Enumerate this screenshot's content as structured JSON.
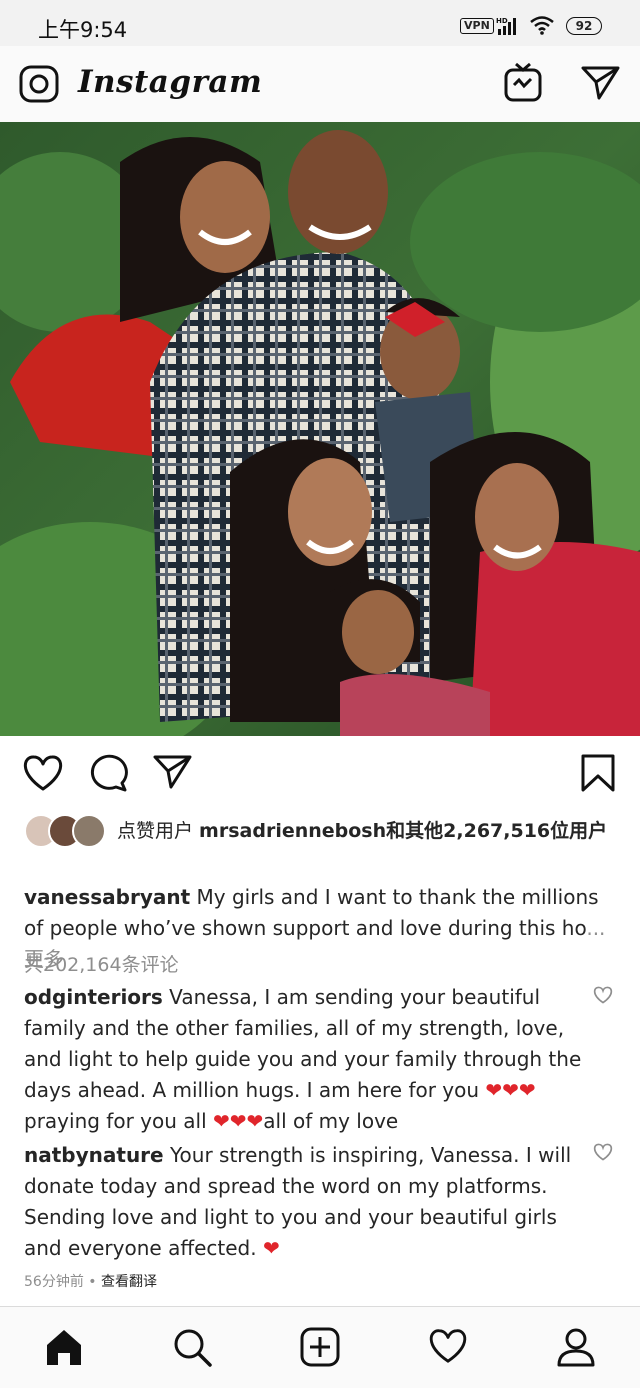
{
  "status_bar": {
    "time": "上午9:54",
    "vpn": "VPN",
    "network": "HD",
    "battery": "92"
  },
  "header": {
    "app_name": "Instagram",
    "icons": [
      "camera-icon",
      "igtv-icon",
      "direct-message-icon"
    ]
  },
  "post": {
    "actions": [
      "like-icon",
      "comment-icon",
      "share-icon",
      "bookmark-icon"
    ],
    "likes": {
      "prefix": "点赞用户 ",
      "user": "mrsadriennebosh",
      "suffix": "和其他2,267,516位用户"
    },
    "caption": {
      "username": "vanessabryant",
      "text": " My girls and I want to thank the millions of people who’ve shown support and love during this ho",
      "more": "...更多"
    },
    "view_all_comments": "共202,164条评论",
    "comments": [
      {
        "username": "odginteriors",
        "text": " Vanessa, I am sending your beautiful family and the other families, all of my strength, love, and light to help guide you and your family through the days ahead. A million hugs. I am here for you ",
        "hearts1": "❤❤❤",
        "text2": " praying for you all ",
        "hearts2": "❤❤❤",
        "text3": "all of my love"
      },
      {
        "username": "natbynature",
        "text": " Your strength is inspiring, Vanessa. I will donate today and spread the word on my platforms. Sending love and light to you and your beautiful girls and everyone affected. ",
        "hearts1": "❤"
      }
    ],
    "time_ago": "56分钟前",
    "separator": " • ",
    "translate": "查看翻译"
  },
  "bottom_nav": [
    "home-icon",
    "search-icon",
    "new-post-icon",
    "activity-icon",
    "profile-icon"
  ],
  "colors": {
    "heart_red": "#e0252b",
    "muted": "#8e8e8e",
    "text": "#262626"
  }
}
